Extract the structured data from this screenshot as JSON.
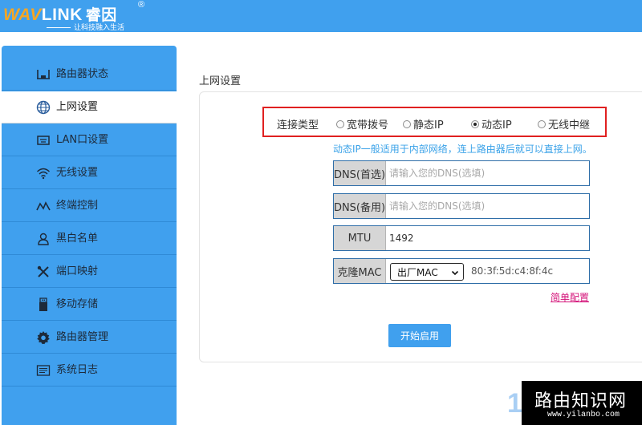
{
  "brand": {
    "logo_prefix": "WAV",
    "logo_suffix": "LINK",
    "logo_cn": "睿因",
    "registered": "®",
    "slogan": "让科技融入生活"
  },
  "sidebar": {
    "items": [
      {
        "label": "路由器状态",
        "icon": "router-status-icon"
      },
      {
        "label": "上网设置",
        "icon": "globe-icon"
      },
      {
        "label": "LAN口设置",
        "icon": "lan-port-icon"
      },
      {
        "label": "无线设置",
        "icon": "wifi-icon"
      },
      {
        "label": "终端控制",
        "icon": "terminal-control-icon"
      },
      {
        "label": "黑白名单",
        "icon": "user-list-icon"
      },
      {
        "label": "端口映射",
        "icon": "tools-icon"
      },
      {
        "label": "移动存储",
        "icon": "usb-storage-icon"
      },
      {
        "label": "路由器管理",
        "icon": "gear-icon"
      },
      {
        "label": "系统日志",
        "icon": "log-icon"
      }
    ],
    "active_index": 1
  },
  "main": {
    "title": "上网设置",
    "connection": {
      "label": "连接类型",
      "options": [
        "宽带拨号",
        "静态IP",
        "动态IP",
        "无线中继"
      ],
      "selected": "动态IP"
    },
    "hint": "动态IP一般适用于内部网络，连上路由器后就可以直接上网。",
    "dns_primary": {
      "label": "DNS(首选)",
      "placeholder": "请输入您的DNS(选填)",
      "value": ""
    },
    "dns_secondary": {
      "label": "DNS(备用)",
      "placeholder": "请输入您的DNS(选填)",
      "value": ""
    },
    "mtu": {
      "label": "MTU",
      "value": "1492"
    },
    "mac_clone": {
      "label": "克隆MAC",
      "selected": "出厂MAC",
      "mac": "80:3f:5d:c4:8f:4c"
    },
    "simple_config_link": "简单配置",
    "start_button": "开始启用"
  },
  "watermark": {
    "digit": "1",
    "title": "路由知识网",
    "url": "www.yilanbo.com"
  },
  "colors": {
    "accent": "#40a0ee",
    "highlight_box": "#e02020",
    "hint": "#3aa2e8",
    "link": "#d4147a"
  }
}
